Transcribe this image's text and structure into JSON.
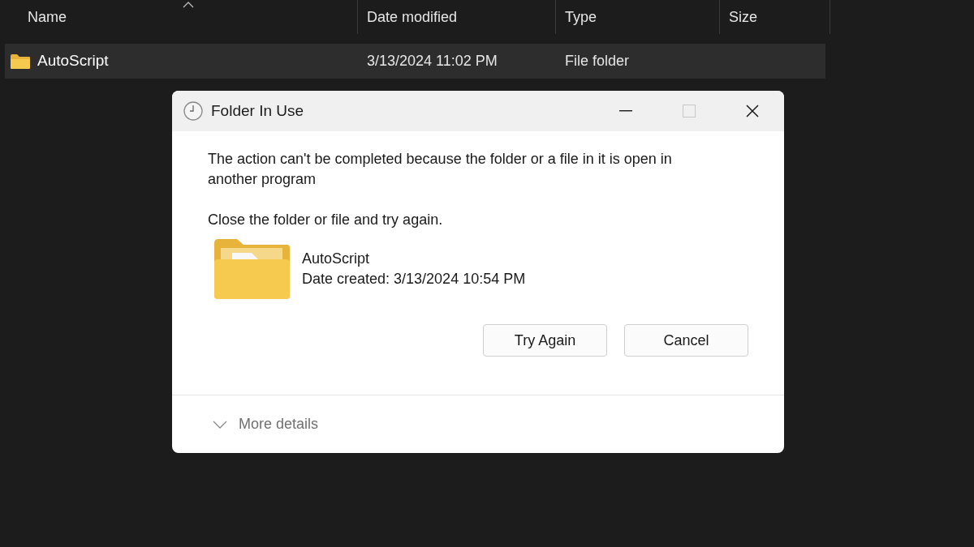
{
  "explorer": {
    "columns": [
      {
        "label": "Name",
        "sorted": true
      },
      {
        "label": "Date modified",
        "sorted": false
      },
      {
        "label": "Type",
        "sorted": false
      },
      {
        "label": "Size",
        "sorted": false
      }
    ],
    "rows": [
      {
        "name": "AutoScript",
        "date_modified": "3/13/2024 11:02 PM",
        "type": "File folder",
        "selected": true
      }
    ]
  },
  "dialog": {
    "title": "Folder In Use",
    "title_buttons": [
      {
        "kind": "minimize",
        "disabled": false
      },
      {
        "kind": "maximize",
        "disabled": true
      },
      {
        "kind": "close",
        "disabled": false
      }
    ],
    "message": "The action can't be completed because the folder or a file in it is open in another program",
    "instruction": "Close the folder or file and try again.",
    "item": {
      "name": "AutoScript",
      "date_created": "Date created: 3/13/2024 10:54 PM"
    },
    "buttons": [
      "Try Again",
      "Cancel"
    ],
    "more_details": {
      "label": "More details",
      "expanded": false
    }
  }
}
